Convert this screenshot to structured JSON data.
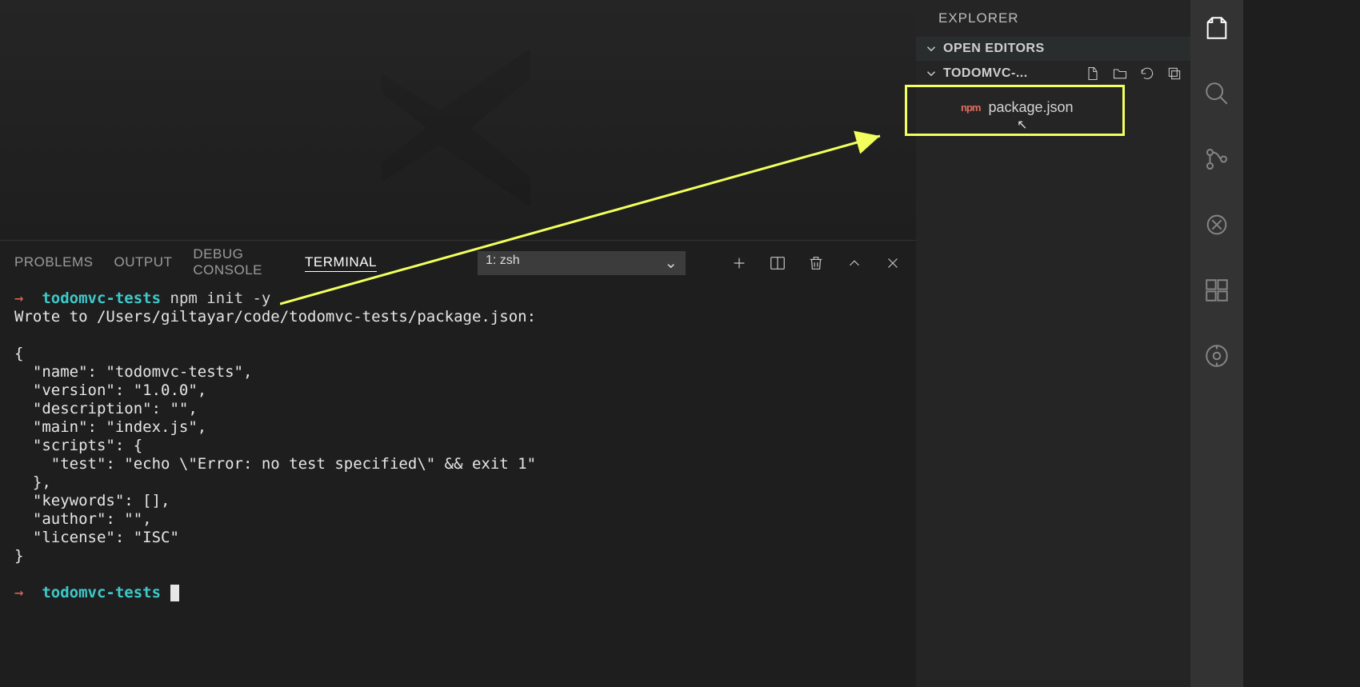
{
  "panel": {
    "tabs": [
      "PROBLEMS",
      "OUTPUT",
      "DEBUG CONSOLE",
      "TERMINAL"
    ],
    "active_tab": 3,
    "shell_selector": "1: zsh"
  },
  "terminal": {
    "cwd": "todomvc-tests",
    "command": "npm init -y",
    "output_lines": [
      "Wrote to /Users/giltayar/code/todomvc-tests/package.json:",
      "",
      "{",
      "  \"name\": \"todomvc-tests\",",
      "  \"version\": \"1.0.0\",",
      "  \"description\": \"\",",
      "  \"main\": \"index.js\",",
      "  \"scripts\": {",
      "    \"test\": \"echo \\\"Error: no test specified\\\" && exit 1\"",
      "  },",
      "  \"keywords\": [],",
      "  \"author\": \"\",",
      "  \"license\": \"ISC\"",
      "}",
      "",
      ""
    ],
    "prompt2_cwd": "todomvc-tests"
  },
  "explorer": {
    "title": "EXPLORER",
    "open_editors_label": "OPEN EDITORS",
    "project_label": "TODOMVC-...",
    "files": [
      {
        "name": "package.json",
        "icon": "npm"
      }
    ]
  },
  "annotation": {
    "highlight_color": "#f2ff5c"
  }
}
